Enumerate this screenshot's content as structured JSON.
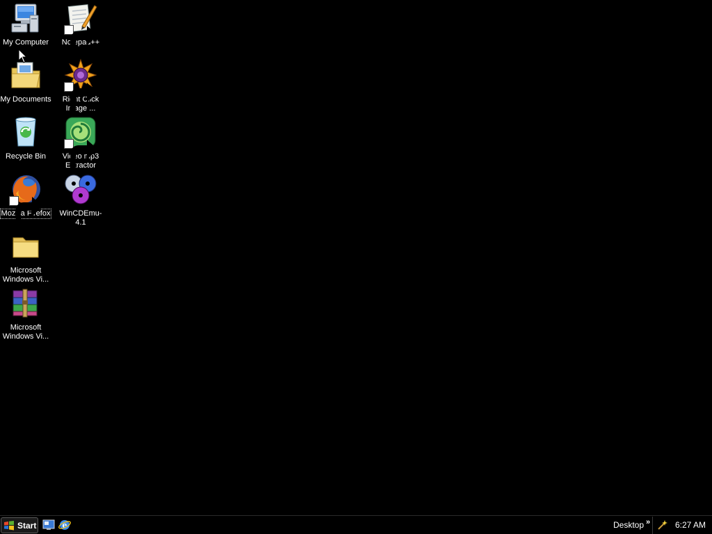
{
  "desktop": {
    "icons": [
      {
        "id": "my-computer",
        "label": "My Computer",
        "shortcut": false,
        "selected": false
      },
      {
        "id": "my-documents",
        "label": "My Documents",
        "shortcut": false,
        "selected": false
      },
      {
        "id": "recycle-bin",
        "label": "Recycle Bin",
        "shortcut": false,
        "selected": false
      },
      {
        "id": "mozilla-firefox",
        "label": "Mozilla Firefox",
        "shortcut": true,
        "selected": true
      },
      {
        "id": "ms-windows-folder",
        "label": "Microsoft Windows Vi...",
        "shortcut": false,
        "selected": false
      },
      {
        "id": "ms-windows-archive",
        "label": "Microsoft Windows Vi...",
        "shortcut": false,
        "selected": false
      },
      {
        "id": "notepad-plus-plus",
        "label": "Notepad++",
        "shortcut": true,
        "selected": false
      },
      {
        "id": "right-click-image",
        "label": "Right Click Image ...",
        "shortcut": true,
        "selected": false
      },
      {
        "id": "video-mp3-extractor",
        "label": "Video mp3 Extractor",
        "shortcut": true,
        "selected": false
      },
      {
        "id": "wincdemu",
        "label": "WinCDEmu-4.1",
        "shortcut": false,
        "selected": false
      }
    ]
  },
  "taskbar": {
    "start_label": "Start",
    "quick_launch": [
      {
        "icon": "show-desktop-icon"
      },
      {
        "icon": "internet-explorer-icon"
      }
    ],
    "toolbar_label": "Desktop",
    "chevron": "»",
    "clock": "6:27 AM"
  },
  "colors": {
    "background": "#000000",
    "text": "#ffffff"
  }
}
